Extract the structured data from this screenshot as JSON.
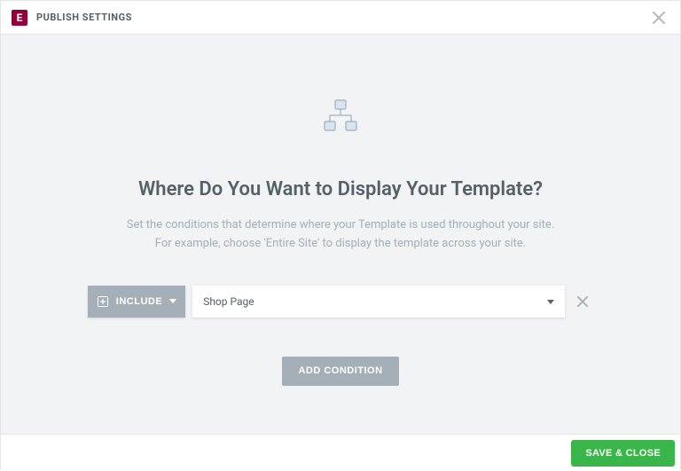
{
  "header": {
    "logo_text": "E",
    "title": "PUBLISH SETTINGS"
  },
  "main": {
    "title": "Where Do You Want to Display Your Template?",
    "subtitle_line1": "Set the conditions that determine where your Template is used throughout your site.",
    "subtitle_line2": "For example, choose 'Entire Site' to display the template across your site."
  },
  "condition": {
    "include_label": "INCLUDE",
    "selected_value": "Shop Page"
  },
  "buttons": {
    "add_condition": "ADD CONDITION",
    "save_close": "SAVE & CLOSE"
  }
}
